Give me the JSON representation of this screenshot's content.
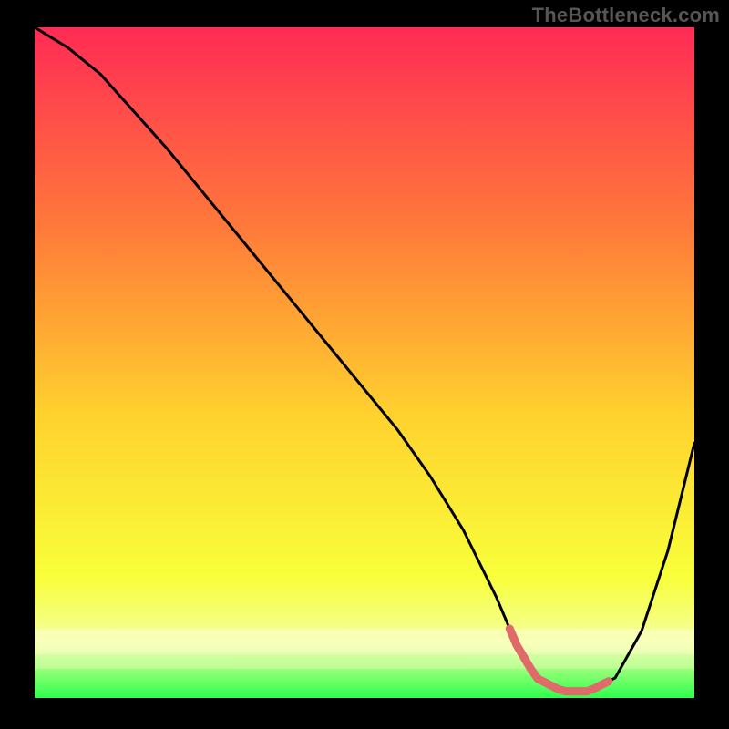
{
  "watermark": "TheBottleneck.com",
  "colors": {
    "background": "#000000",
    "gradient_top": "#ff2b55",
    "gradient_mid_upper": "#ff7a3a",
    "gradient_mid": "#ffd22e",
    "gradient_lower": "#f8ff3a",
    "gradient_bottom_yellow": "#f4ffa0",
    "gradient_bottom_green": "#2dff4d",
    "curve_stroke": "#000000",
    "highlight_stroke": "#e06a6a"
  },
  "chart_data": {
    "type": "line",
    "title": "",
    "xlabel": "",
    "ylabel": "",
    "xlim": [
      0,
      100
    ],
    "ylim": [
      0,
      100
    ],
    "series": [
      {
        "name": "curve",
        "x": [
          0,
          5,
          10,
          20,
          30,
          40,
          50,
          55,
          60,
          65,
          70,
          73,
          76,
          80,
          84,
          88,
          92,
          96,
          100
        ],
        "y": [
          100,
          97,
          93,
          82,
          70,
          58,
          46,
          40,
          33,
          25,
          15,
          8,
          3,
          1,
          1,
          3,
          10,
          22,
          38
        ]
      }
    ],
    "highlight_segment": {
      "x_start": 72,
      "x_end": 87,
      "approx_y": 1
    },
    "gradient_stops": [
      {
        "offset": 0.0,
        "color": "#ff2b55"
      },
      {
        "offset": 0.3,
        "color": "#ff7a3a"
      },
      {
        "offset": 0.58,
        "color": "#ffd22e"
      },
      {
        "offset": 0.82,
        "color": "#f8ff3a"
      },
      {
        "offset": 0.92,
        "color": "#f4ffa0"
      },
      {
        "offset": 1.0,
        "color": "#2dff4d"
      }
    ]
  }
}
